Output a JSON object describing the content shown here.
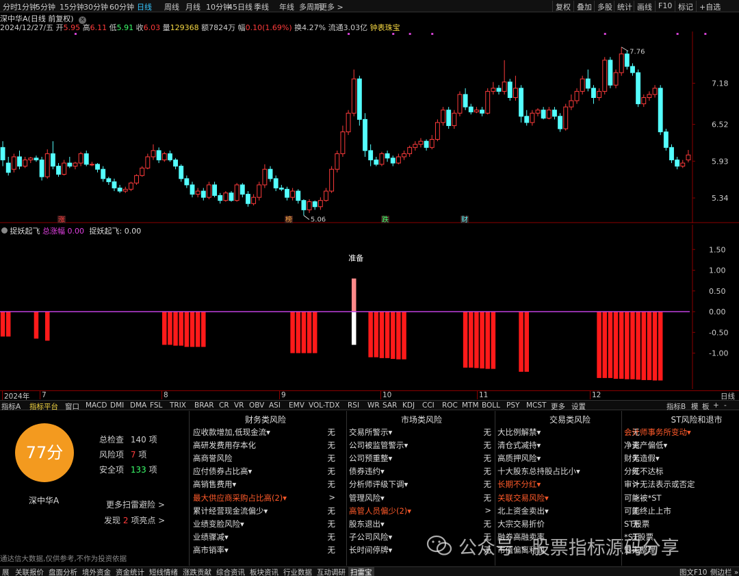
{
  "period_tabs": [
    "分时",
    "1分钟",
    "5分钟",
    "15分钟",
    "30分钟",
    "60分钟",
    "日线",
    "周线",
    "月线",
    "10分钟",
    "45日线",
    "季线",
    "年线",
    "多周期",
    "更多 >"
  ],
  "period_active": "日线",
  "right_buttons": [
    "复权",
    "叠加",
    "多股",
    "统计",
    "画线",
    "F10",
    "标记",
    "+自选"
  ],
  "stock_title": "深中华A(日线 前复权)",
  "info": {
    "date": "2024/12/27/五",
    "open_label": "开",
    "open": "5.95",
    "high_label": "高",
    "high": "6.11",
    "low_label": "低",
    "low": "5.91",
    "close_label": "收",
    "close": "6.03",
    "volume_label": "量",
    "volume": "129368",
    "amount_label": "额",
    "amount": "7824万",
    "change_label": "幅",
    "change": "0.10(1.69%)",
    "turnover_label": "换",
    "turnover": "4.27%",
    "float_label": "流通",
    "float": "3.03亿",
    "extra": "钟表珠宝"
  },
  "price_axis": [
    "7.18",
    "6.52",
    "5.93",
    "5.34"
  ],
  "markers": {
    "high": "7.76",
    "low": "5.06"
  },
  "event_tags": [
    "涨",
    "榜",
    "跌",
    "财"
  ],
  "indicator": {
    "name": "捉妖起飞",
    "series1_label": "总涨幅",
    "series1_value": "0.00",
    "series2_label": "捉妖起飞:",
    "series2_value": "0.00",
    "annotation": "准备"
  },
  "sub_axis": [
    "1.50",
    "1.00",
    "0.50",
    "0.00",
    "-0.50",
    "-1.00"
  ],
  "time_axis": [
    "2024年",
    "7",
    "8",
    "9",
    "10",
    "11",
    "12"
  ],
  "time_axis_right": "日线",
  "indicator_tabs": [
    "指标A",
    "指标平台",
    "窗口",
    "MACD",
    "DMI",
    "DMA",
    "FSL",
    "TRIX",
    "BRAR",
    "CR",
    "VR",
    "OBV",
    "ASI",
    "EMV",
    "VOL-TDX",
    "RSI",
    "WR",
    "SAR",
    "KDJ",
    "CCI",
    "ROC",
    "MTM",
    "BOLL",
    "PSY",
    "MCST",
    "更多",
    "设置"
  ],
  "indicator_tabs_right": [
    "指标B",
    "模",
    "板",
    "+",
    "-"
  ],
  "risk": {
    "score": "77分",
    "stock_name": "深中华A",
    "total_label": "总检查",
    "total": "140",
    "total_unit": "项",
    "risk_label": "风险项",
    "risk_count": "7",
    "risk_unit": "项",
    "safe_label": "安全项",
    "safe_count": "133",
    "safe_unit": "项",
    "more_link": "更多扫雷避险 >",
    "found_prefix": "发现",
    "found_count": "2",
    "found_suffix": "项亮点 >",
    "disclaimer": "通达信大数据,仅供参考,不作为投资依据",
    "columns": [
      {
        "title": "财务类风险",
        "items": [
          {
            "label": "应收款增加,低现金流▾",
            "value": "无"
          },
          {
            "label": "高研发费用存本化",
            "value": "无"
          },
          {
            "label": "高商誉风险",
            "value": "无"
          },
          {
            "label": "应付债券占比高▾",
            "value": "无"
          },
          {
            "label": "高销售费用▾",
            "value": "无"
          },
          {
            "label": "最大供应商采购占比高(2)▾",
            "value": ">",
            "hi": true
          },
          {
            "label": "累计经营现金流偏少▾",
            "value": "无"
          },
          {
            "label": "业绩变脸风险▾",
            "value": "无"
          },
          {
            "label": "业绩骤减▾",
            "value": "无"
          },
          {
            "label": "高市销率▾",
            "value": "无"
          }
        ]
      },
      {
        "title": "市场类风险",
        "items": [
          {
            "label": "交易所警示▾",
            "value": "无"
          },
          {
            "label": "公司被监管警示▾",
            "value": "无"
          },
          {
            "label": "公司预重整▾",
            "value": "无"
          },
          {
            "label": "债券违约▾",
            "value": "无"
          },
          {
            "label": "分析师评级下调▾",
            "value": "无"
          },
          {
            "label": "管理风险▾",
            "value": "无"
          },
          {
            "label": "高管人员偏少(2)▾",
            "value": ">",
            "hi": true
          },
          {
            "label": "股东退出▾",
            "value": "无"
          },
          {
            "label": "子公司风险▾",
            "value": "无"
          },
          {
            "label": "长时间停牌▾",
            "value": "无"
          }
        ]
      },
      {
        "title": "交易类风险",
        "items": [
          {
            "label": "大比例解禁▾",
            "value": "无"
          },
          {
            "label": "清仓式减持▾",
            "value": "无"
          },
          {
            "label": "高质押风险▾",
            "value": "无"
          },
          {
            "label": "十大股东总持股占比小▾",
            "value": "无"
          },
          {
            "label": "长期不分红▾",
            "value": ">",
            "hi": true
          },
          {
            "label": "关联交易风险▾",
            "value": ">",
            "hi": true
          },
          {
            "label": "北上资金卖出▾",
            "value": "无"
          },
          {
            "label": "大宗交易折价",
            "value": "无"
          },
          {
            "label": "融券高融卖率",
            "value": "无"
          },
          {
            "label": "市值偏离利润",
            "value": "无"
          }
        ]
      },
      {
        "title": "ST风险和退市",
        "items": [
          {
            "label": "会计师事务所变动▾",
            "value": ">",
            "hi": true
          },
          {
            "label": "净资产偏低▾",
            "value": "无"
          },
          {
            "label": "财务造假▾",
            "value": "无"
          },
          {
            "label": "分红不达标",
            "value": "无"
          },
          {
            "label": "审计无法表示或否定",
            "value": "无"
          },
          {
            "label": "可能被*ST",
            "value": "无"
          },
          {
            "label": "可能终止上市",
            "value": "无"
          },
          {
            "label": "ST股票",
            "value": "无"
          },
          {
            "label": "*ST股票",
            "value": "无"
          },
          {
            "label": "退市整理",
            "value": "无"
          }
        ]
      }
    ]
  },
  "status_tabs": [
    "展",
    "关联报价",
    "盘面分析",
    "境外资金",
    "资金统计",
    "短线情绪",
    "涨跌贡献",
    "综合资讯",
    "板块资讯",
    "行业数据",
    "互动调研",
    "扫雷宝"
  ],
  "status_active": "扫雷宝",
  "status_right": [
    "图文F10",
    "侧边栏 »"
  ],
  "watermark": "公众号 · 股票指标源码分享",
  "colors": {
    "up": "#ff3b3b",
    "down": "#54ffff",
    "bar_neg": "#ff1a1a",
    "accent": "#f39a1f",
    "highlight": "#ff5a2a"
  },
  "chart_data": {
    "type": "candlestick",
    "title": "深中华A(日线 前复权)",
    "y_range": [
      5.0,
      7.9
    ],
    "candles": [
      [
        6.15,
        5.95,
        6.25,
        5.85
      ],
      [
        5.9,
        5.75,
        6.0,
        5.7
      ],
      [
        5.8,
        6.0,
        6.05,
        5.75
      ],
      [
        6.0,
        5.85,
        6.1,
        5.8
      ],
      [
        5.85,
        5.95,
        6.0,
        5.82
      ],
      [
        5.95,
        5.98,
        6.0,
        5.9
      ],
      [
        5.98,
        5.95,
        6.02,
        5.92
      ],
      [
        5.95,
        5.68,
        6.0,
        5.62
      ],
      [
        5.68,
        6.05,
        6.12,
        5.65
      ],
      [
        6.05,
        5.85,
        6.25,
        5.8
      ],
      [
        5.85,
        5.72,
        5.9,
        5.68
      ],
      [
        5.72,
        5.9,
        5.95,
        5.7
      ],
      [
        5.9,
        5.85,
        6.0,
        5.82
      ],
      [
        5.85,
        5.9,
        5.92,
        5.8
      ],
      [
        5.9,
        6.05,
        6.08,
        5.85
      ],
      [
        6.05,
        5.88,
        6.1,
        5.85
      ],
      [
        5.88,
        5.88,
        5.92,
        5.85
      ],
      [
        5.88,
        5.8,
        5.9,
        5.75
      ],
      [
        5.8,
        5.65,
        5.85,
        5.6
      ],
      [
        5.65,
        5.6,
        5.68,
        5.55
      ],
      [
        5.6,
        5.5,
        5.65,
        5.45
      ],
      [
        5.5,
        5.45,
        5.55,
        5.42
      ],
      [
        5.45,
        5.48,
        5.52,
        5.42
      ],
      [
        5.48,
        5.58,
        5.6,
        5.45
      ],
      [
        5.58,
        5.7,
        5.72,
        5.55
      ],
      [
        5.7,
        5.82,
        5.85,
        5.68
      ],
      [
        5.82,
        6.0,
        6.05,
        5.8
      ],
      [
        6.0,
        6.1,
        6.2,
        5.95
      ],
      [
        6.1,
        5.95,
        6.15,
        5.9
      ],
      [
        5.95,
        6.05,
        6.08,
        5.92
      ],
      [
        6.05,
        5.95,
        6.1,
        5.92
      ],
      [
        5.95,
        5.85,
        5.98,
        5.8
      ],
      [
        5.85,
        5.65,
        5.88,
        5.6
      ],
      [
        5.65,
        5.55,
        5.7,
        5.5
      ],
      [
        5.55,
        5.4,
        5.6,
        5.35
      ],
      [
        5.4,
        5.45,
        5.5,
        5.35
      ],
      [
        5.45,
        5.35,
        5.5,
        5.3
      ],
      [
        5.35,
        5.55,
        5.6,
        5.32
      ],
      [
        5.55,
        5.38,
        5.6,
        5.35
      ],
      [
        5.38,
        5.3,
        5.42,
        5.25
      ],
      [
        5.3,
        5.42,
        5.45,
        5.28
      ],
      [
        5.42,
        5.3,
        5.45,
        5.28
      ],
      [
        5.3,
        5.55,
        5.58,
        5.28
      ],
      [
        5.55,
        5.4,
        5.58,
        5.35
      ],
      [
        5.4,
        5.25,
        5.45,
        5.2
      ],
      [
        5.25,
        5.35,
        5.4,
        5.22
      ],
      [
        5.35,
        5.55,
        5.6,
        5.3
      ],
      [
        5.55,
        5.8,
        5.88,
        5.5
      ],
      [
        5.8,
        5.65,
        5.85,
        5.6
      ],
      [
        5.65,
        5.5,
        5.7,
        5.45
      ],
      [
        5.5,
        5.48,
        5.55,
        5.45
      ],
      [
        5.48,
        5.35,
        5.52,
        5.3
      ],
      [
        5.35,
        5.45,
        5.5,
        5.3
      ],
      [
        5.45,
        5.3,
        5.48,
        5.25
      ],
      [
        5.3,
        5.15,
        5.32,
        5.06
      ],
      [
        5.15,
        5.28,
        5.32,
        5.1
      ],
      [
        5.28,
        5.2,
        5.3,
        5.15
      ],
      [
        5.2,
        5.3,
        5.35,
        5.15
      ],
      [
        5.3,
        5.45,
        5.5,
        5.28
      ],
      [
        5.45,
        5.8,
        5.85,
        5.42
      ],
      [
        5.8,
        6.05,
        6.1,
        5.75
      ],
      [
        6.05,
        6.4,
        6.5,
        6.0
      ],
      [
        6.4,
        6.7,
        6.75,
        6.35
      ],
      [
        6.7,
        7.25,
        7.4,
        6.65
      ],
      [
        7.25,
        6.6,
        7.3,
        6.5
      ],
      [
        6.6,
        6.1,
        6.7,
        6.0
      ],
      [
        6.1,
        5.95,
        6.2,
        5.85
      ],
      [
        5.95,
        5.88,
        6.0,
        5.85
      ],
      [
        5.88,
        6.05,
        6.08,
        5.85
      ],
      [
        6.05,
        5.98,
        6.1,
        5.92
      ],
      [
        5.98,
        5.9,
        6.02,
        5.85
      ],
      [
        5.9,
        6.0,
        6.05,
        5.88
      ],
      [
        6.0,
        6.05,
        6.1,
        5.95
      ],
      [
        6.05,
        6.15,
        6.18,
        6.0
      ],
      [
        6.15,
        6.2,
        6.25,
        6.1
      ],
      [
        6.2,
        6.25,
        6.3,
        6.15
      ],
      [
        6.25,
        6.15,
        6.28,
        6.1
      ],
      [
        6.15,
        6.28,
        6.35,
        6.12
      ],
      [
        6.28,
        6.55,
        6.6,
        6.25
      ],
      [
        6.55,
        6.75,
        6.8,
        6.5
      ],
      [
        6.75,
        6.5,
        6.8,
        6.45
      ],
      [
        6.5,
        6.7,
        6.75,
        6.45
      ],
      [
        6.7,
        7.0,
        7.05,
        6.65
      ],
      [
        7.0,
        6.8,
        7.1,
        6.75
      ],
      [
        6.8,
        6.72,
        6.85,
        6.68
      ],
      [
        6.72,
        6.75,
        6.8,
        6.7
      ],
      [
        6.75,
        6.7,
        6.8,
        6.65
      ],
      [
        6.7,
        7.05,
        7.1,
        6.68
      ],
      [
        7.05,
        7.1,
        7.2,
        7.0
      ],
      [
        7.1,
        7.05,
        7.15,
        7.0
      ],
      [
        7.05,
        7.2,
        7.55,
        7.0
      ],
      [
        7.2,
        6.95,
        7.25,
        6.9
      ],
      [
        6.95,
        7.1,
        7.3,
        6.9
      ],
      [
        7.1,
        6.65,
        7.15,
        6.55
      ],
      [
        6.65,
        6.55,
        6.75,
        6.5
      ],
      [
        6.55,
        6.7,
        6.75,
        6.5
      ],
      [
        6.7,
        6.75,
        6.78,
        6.65
      ],
      [
        6.75,
        6.62,
        6.8,
        6.6
      ],
      [
        6.62,
        6.75,
        6.8,
        6.6
      ],
      [
        6.75,
        6.65,
        6.8,
        6.6
      ],
      [
        6.65,
        6.45,
        6.7,
        6.4
      ],
      [
        6.45,
        6.8,
        6.85,
        6.42
      ],
      [
        6.8,
        6.9,
        7.0,
        6.75
      ],
      [
        6.9,
        7.05,
        7.1,
        6.85
      ],
      [
        7.05,
        7.25,
        7.3,
        7.0
      ],
      [
        7.25,
        7.1,
        7.4,
        7.05
      ],
      [
        7.1,
        6.95,
        7.15,
        6.85
      ],
      [
        6.95,
        7.05,
        7.1,
        6.9
      ],
      [
        7.05,
        7.55,
        7.6,
        7.0
      ],
      [
        7.55,
        7.15,
        7.6,
        7.1
      ],
      [
        7.15,
        7.35,
        7.4,
        7.1
      ],
      [
        7.35,
        7.65,
        7.76,
        7.3
      ],
      [
        7.65,
        7.45,
        7.7,
        7.4
      ],
      [
        7.45,
        7.35,
        7.5,
        7.3
      ],
      [
        7.35,
        6.85,
        7.4,
        6.8
      ],
      [
        6.85,
        6.95,
        7.0,
        6.8
      ],
      [
        6.95,
        7.0,
        7.05,
        6.9
      ],
      [
        7.0,
        7.1,
        7.15,
        6.95
      ],
      [
        7.1,
        6.4,
        7.15,
        6.35
      ],
      [
        6.4,
        6.15,
        6.45,
        6.1
      ],
      [
        6.15,
        5.95,
        6.2,
        5.9
      ],
      [
        5.95,
        5.85,
        6.0,
        5.8
      ],
      [
        5.85,
        5.9,
        5.95,
        5.82
      ],
      [
        5.95,
        6.03,
        6.11,
        5.91
      ]
    ],
    "indicator_bars": [
      -0.6,
      -0.6,
      0,
      0,
      0,
      0,
      -0.65,
      0,
      -0.7,
      0,
      0,
      0,
      0,
      0,
      0,
      0,
      0,
      0,
      0,
      0,
      0,
      0,
      0,
      0,
      0,
      0,
      0,
      0,
      0,
      -0.8,
      -0.8,
      -0.82,
      -0.82,
      -0.85,
      -0.85,
      -0.85,
      -0.85,
      0,
      0,
      0,
      0,
      0,
      0,
      0,
      0,
      0,
      0,
      0,
      0,
      0,
      0,
      0,
      -1.0,
      -1.0,
      -1.0,
      -1.0,
      -1.0,
      0,
      0,
      0,
      0,
      0,
      0,
      0,
      0,
      0,
      -1.1,
      -1.1,
      -1.12,
      -1.12,
      -1.14,
      -1.15,
      -1.15,
      0,
      0,
      0,
      0,
      0,
      0,
      0,
      0,
      0,
      0,
      -1.35,
      -1.35,
      -1.36,
      -1.37,
      -1.38,
      -1.38,
      0,
      0,
      0,
      0,
      -1.45,
      -1.45,
      0,
      0,
      0,
      0,
      0,
      0,
      0,
      0,
      0,
      0,
      0,
      0,
      -1.6,
      -1.6,
      -1.6,
      -1.62,
      -1.62,
      -1.63,
      -1.63,
      -1.64,
      -1.65,
      -1.65,
      -1.66,
      -1.66,
      0,
      0,
      0,
      0,
      0,
      0,
      0,
      0
    ],
    "signal_bar": {
      "index": 63,
      "from": -0.8,
      "to": 0.8
    },
    "sub_y_range": [
      -1.8,
      2.0
    ]
  }
}
